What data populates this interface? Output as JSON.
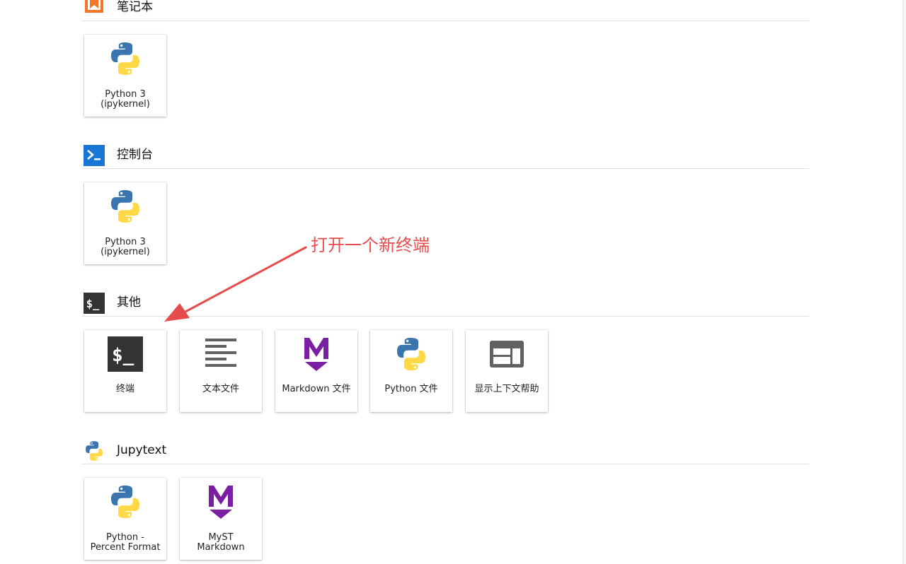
{
  "sections": [
    {
      "id": "notebook",
      "title": "笔记本",
      "icon": "notebook-bookmark-icon",
      "cards": [
        {
          "label": "Python 3\n(ipykernel)",
          "icon": "python-logo-icon"
        }
      ]
    },
    {
      "id": "console",
      "title": "控制台",
      "icon": "console-prompt-icon",
      "cards": [
        {
          "label": "Python 3\n(ipykernel)",
          "icon": "python-logo-icon"
        }
      ]
    },
    {
      "id": "other",
      "title": "其他",
      "icon": "terminal-dollar-icon",
      "cards": [
        {
          "label": "终端",
          "icon": "terminal-dollar-icon"
        },
        {
          "label": "文本文件",
          "icon": "text-lines-icon"
        },
        {
          "label": "Markdown 文件",
          "icon": "markdown-m-icon"
        },
        {
          "label": "Python 文件",
          "icon": "python-logo-icon"
        },
        {
          "label": "显示上下文帮助",
          "icon": "context-help-window-icon"
        }
      ]
    },
    {
      "id": "jupytext",
      "title": "Jupytext",
      "icon": "python-logo-icon",
      "cards": [
        {
          "label": "Python -\nPercent Format",
          "icon": "python-logo-icon"
        },
        {
          "label": "MyST\nMarkdown",
          "icon": "markdown-m-icon"
        }
      ]
    }
  ],
  "annotation": {
    "text": "打开一个新终端",
    "color": "#e74c4c"
  },
  "colors": {
    "notebook_orange": "#f37726",
    "console_blue": "#1976d2",
    "terminal_dark": "#333333",
    "markdown_purple": "#7b1fa2",
    "python_blue": "#3a75b0",
    "python_yellow": "#ffd845"
  }
}
